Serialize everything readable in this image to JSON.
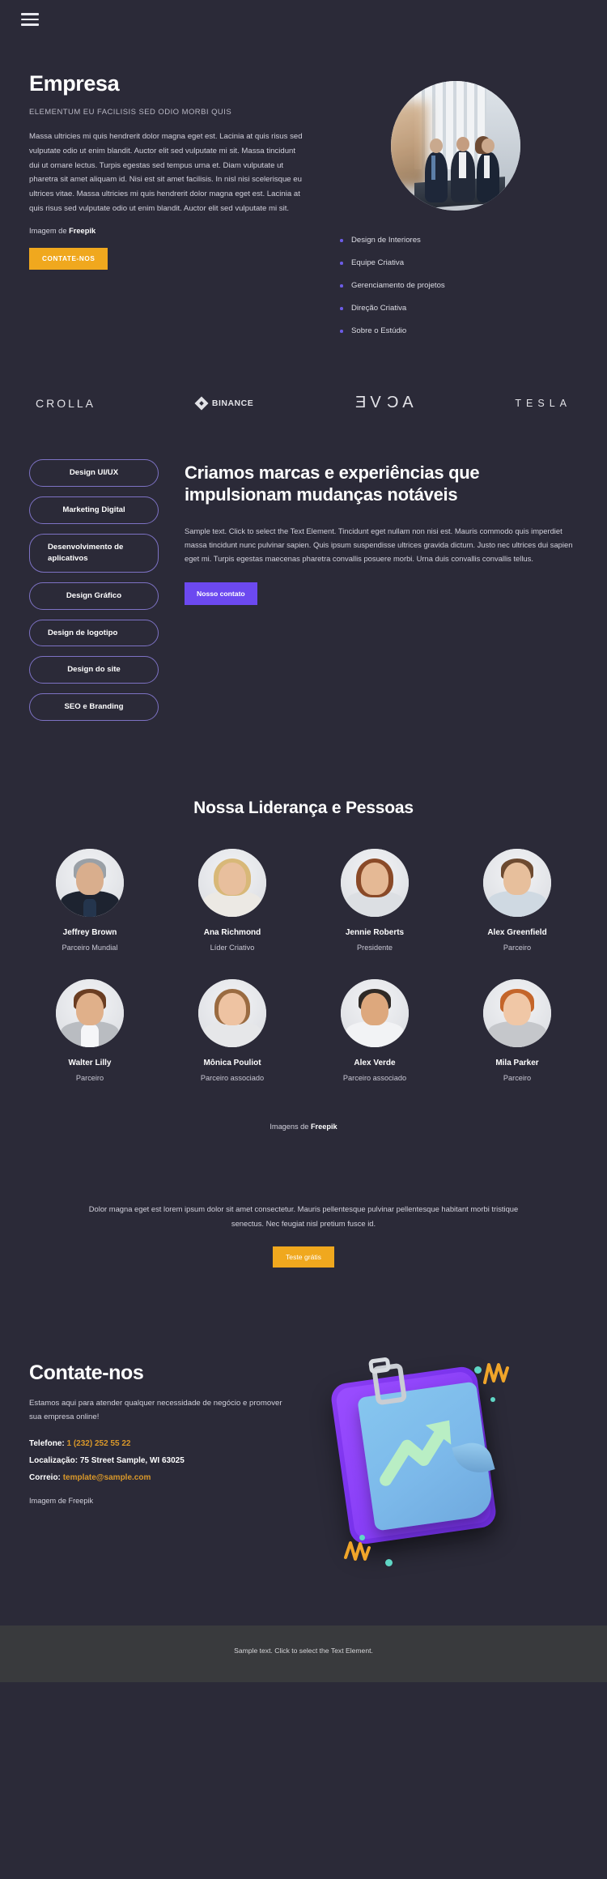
{
  "header": {
    "menu_icon": "hamburger-menu-icon"
  },
  "hero": {
    "title": "Empresa",
    "subtitle": "ELEMENTUM EU FACILISIS SED ODIO MORBI QUIS",
    "body": "Massa ultricies mi quis hendrerit dolor magna eget est. Lacinia at quis risus sed vulputate odio ut enim blandit. Auctor elit sed vulputate mi sit. Massa tincidunt dui ut ornare lectus. Turpis egestas sed tempus urna et. Diam vulputate ut pharetra sit amet aliquam id. Nisi est sit amet facilisis. In nisl nisi scelerisque eu ultrices vitae. Massa ultricies mi quis hendrerit dolor magna eget est. Lacinia at quis risus sed vulputate odio ut enim blandit. Auctor elit sed vulputate mi sit.",
    "credit_prefix": "Imagem de ",
    "credit_brand": "Freepik",
    "cta_label": "CONTATE-NOS",
    "photo_alt": "business-team-meeting-photo",
    "list": [
      "Design de Interiores",
      "Equipe Criativa",
      "Gerenciamento de projetos",
      "Direção Criativa",
      "Sobre o Estúdio"
    ]
  },
  "logos": [
    {
      "name": "CROLLA",
      "id": "crolla-logo"
    },
    {
      "name": "BINANCE",
      "id": "binance-logo"
    },
    {
      "name": "EVGA",
      "id": "evga-logo"
    },
    {
      "name": "TESLA",
      "id": "tesla-logo"
    }
  ],
  "services": {
    "pills": [
      "Design UI/UX",
      "Marketing Digital",
      "Desenvolvimento de aplicativos",
      "Design Gráfico",
      "Design de logotipo",
      "Design do site",
      "SEO e Branding"
    ],
    "title": "Criamos marcas e experiências que impulsionam mudanças notáveis",
    "body": "Sample text. Click to select the Text Element. Tincidunt eget nullam non nisi est. Mauris commodo quis imperdiet massa tincidunt nunc pulvinar sapien. Quis ipsum suspendisse ultrices gravida dictum. Justo nec ultrices dui sapien eget mi. Turpis egestas maecenas pharetra convallis posuere morbi. Urna duis convallis convallis tellus.",
    "cta_label": "Nosso contato"
  },
  "team": {
    "title": "Nossa Liderança e Pessoas",
    "credit_prefix": "Imagens de ",
    "credit_brand": "Freepik",
    "row1": [
      {
        "name": "Jeffrey Brown",
        "role": "Parceiro Mundial"
      },
      {
        "name": "Ana Richmond",
        "role": "Líder Criativo"
      },
      {
        "name": "Jennie Roberts",
        "role": "Presidente"
      },
      {
        "name": "Alex Greenfield",
        "role": "Parceiro"
      }
    ],
    "row2": [
      {
        "name": "Walter Lilly",
        "role": "Parceiro"
      },
      {
        "name": "Mônica Pouliot",
        "role": "Parceiro associado"
      },
      {
        "name": "Alex Verde",
        "role": "Parceiro associado"
      },
      {
        "name": "Mila Parker",
        "role": "Parceiro"
      }
    ]
  },
  "cta": {
    "text": "Dolor magna eget est lorem ipsum dolor sit amet consectetur. Mauris pellentesque pulvinar pellentesque habitant morbi tristique senectus. Nec feugiat nisl pretium fusce id.",
    "button_label": "Teste grátis"
  },
  "contact": {
    "title": "Contate-nos",
    "lead": "Estamos aqui para atender qualquer necessidade de negócio e promover sua empresa online!",
    "phone_label": "Telefone:",
    "phone_value": "1 (232) 252 55 22",
    "location_label": "Localização:",
    "location_value": "75 Street Sample, WI 63025",
    "mail_label": "Correio:",
    "mail_value": "template@sample.com",
    "credit": "Imagem de Freepik",
    "illustration_alt": "3d-clipboard-growth-chart-illustration"
  },
  "footer": {
    "text": "Sample text. Click to select the Text Element."
  },
  "colors": {
    "background": "#2b2a38",
    "footer_background": "#393a3d",
    "gold": "#f0a81e",
    "purple": "#6c49f0",
    "pill_border": "#7d72c4",
    "bullet": "#6c5ce7",
    "contact_gold": "#d9982a"
  }
}
